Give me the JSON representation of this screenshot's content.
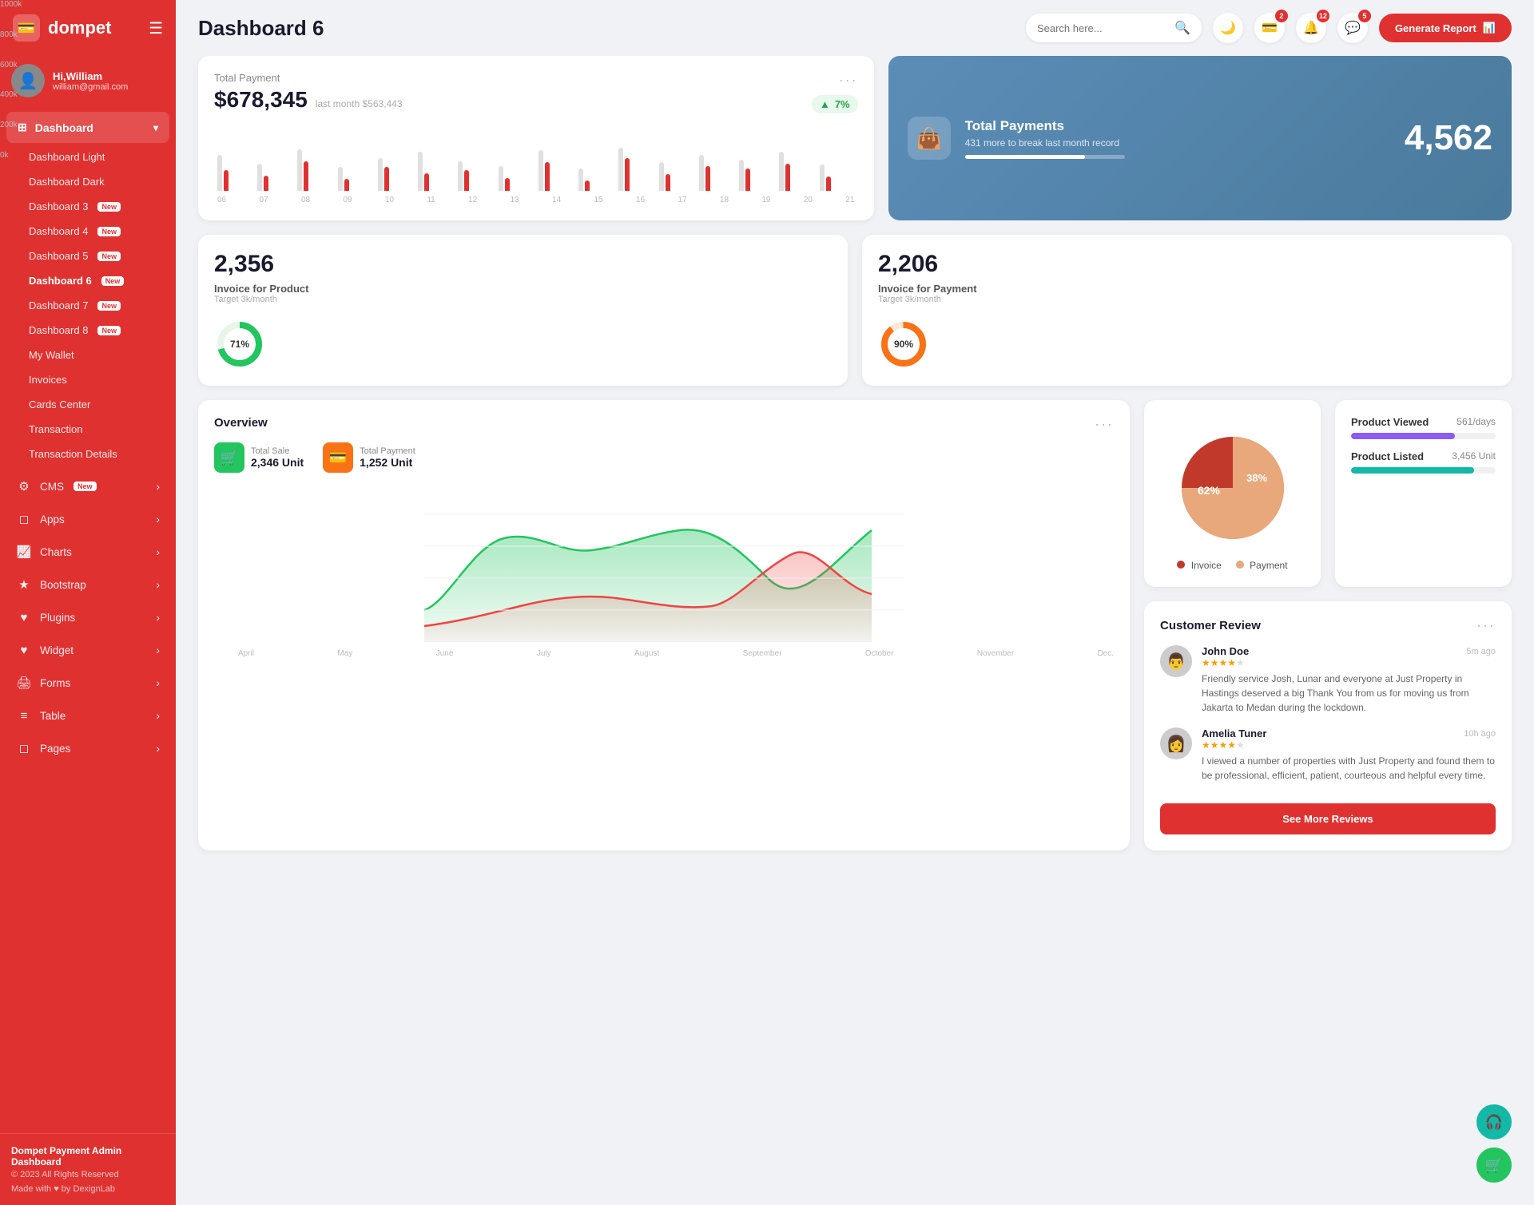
{
  "sidebar": {
    "logo": "dompet",
    "logo_icon": "💳",
    "user": {
      "greeting": "Hi,William",
      "email": "william@gmail.com",
      "avatar": "👤"
    },
    "dashboard_section": {
      "label": "Dashboard",
      "icon": "⊞",
      "items": [
        {
          "label": "Dashboard Light",
          "badge": ""
        },
        {
          "label": "Dashboard Dark",
          "badge": ""
        },
        {
          "label": "Dashboard 3",
          "badge": "New"
        },
        {
          "label": "Dashboard 4",
          "badge": "New"
        },
        {
          "label": "Dashboard 5",
          "badge": "New"
        },
        {
          "label": "Dashboard 6",
          "badge": "New",
          "active": true
        },
        {
          "label": "Dashboard 7",
          "badge": "New"
        },
        {
          "label": "Dashboard 8",
          "badge": "New"
        },
        {
          "label": "My Wallet",
          "badge": ""
        },
        {
          "label": "Invoices",
          "badge": ""
        },
        {
          "label": "Cards Center",
          "badge": ""
        },
        {
          "label": "Transaction",
          "badge": ""
        },
        {
          "label": "Transaction Details",
          "badge": ""
        }
      ]
    },
    "nav_items": [
      {
        "label": "CMS",
        "icon": "⚙",
        "badge": "New",
        "has_arrow": true
      },
      {
        "label": "Apps",
        "icon": "◻",
        "badge": "",
        "has_arrow": true
      },
      {
        "label": "Charts",
        "icon": "📈",
        "badge": "",
        "has_arrow": true
      },
      {
        "label": "Bootstrap",
        "icon": "★",
        "badge": "",
        "has_arrow": true
      },
      {
        "label": "Plugins",
        "icon": "♥",
        "badge": "",
        "has_arrow": true
      },
      {
        "label": "Widget",
        "icon": "♥",
        "badge": "",
        "has_arrow": true
      },
      {
        "label": "Forms",
        "icon": "🖨",
        "badge": "",
        "has_arrow": true
      },
      {
        "label": "Table",
        "icon": "≡",
        "badge": "",
        "has_arrow": true
      },
      {
        "label": "Pages",
        "icon": "◻",
        "badge": "",
        "has_arrow": true
      }
    ],
    "footer": {
      "brand": "Dompet Payment Admin Dashboard",
      "copy": "© 2023 All Rights Reserved",
      "made": "Made with ♥ by DexignLab"
    }
  },
  "topbar": {
    "title": "Dashboard 6",
    "search_placeholder": "Search here...",
    "badges": {
      "wallet": "2",
      "bell": "12",
      "chat": "5"
    },
    "generate_btn": "Generate Report"
  },
  "total_payment": {
    "label": "Total Payment",
    "amount": "$678,345",
    "last_month_label": "last month",
    "last_month_value": "$563,443",
    "trend": "7%",
    "bar_labels": [
      "06",
      "07",
      "08",
      "09",
      "10",
      "11",
      "12",
      "13",
      "14",
      "15",
      "16",
      "17",
      "18",
      "19",
      "20",
      "21"
    ],
    "bars": [
      {
        "gray": 60,
        "red": 35
      },
      {
        "gray": 45,
        "red": 25
      },
      {
        "gray": 70,
        "red": 50
      },
      {
        "gray": 40,
        "red": 20
      },
      {
        "gray": 55,
        "red": 40
      },
      {
        "gray": 65,
        "red": 30
      },
      {
        "gray": 50,
        "red": 35
      },
      {
        "gray": 42,
        "red": 22
      },
      {
        "gray": 68,
        "red": 48
      },
      {
        "gray": 38,
        "red": 18
      },
      {
        "gray": 72,
        "red": 55
      },
      {
        "gray": 48,
        "red": 28
      },
      {
        "gray": 60,
        "red": 42
      },
      {
        "gray": 52,
        "red": 38
      },
      {
        "gray": 65,
        "red": 45
      },
      {
        "gray": 44,
        "red": 24
      }
    ]
  },
  "total_payments_blue": {
    "title": "Total Payments",
    "sub": "431 more to break last month record",
    "value": "4,562",
    "progress": 75,
    "icon": "👜"
  },
  "invoice_product": {
    "value": "2,356",
    "label": "Invoice for Product",
    "target": "Target 3k/month",
    "percent": 71,
    "color": "#22c55e"
  },
  "invoice_payment": {
    "value": "2,206",
    "label": "Invoice for Payment",
    "target": "Target 3k/month",
    "percent": 90,
    "color": "#f97316"
  },
  "overview": {
    "title": "Overview",
    "total_sale_label": "Total Sale",
    "total_sale_value": "2,346 Unit",
    "total_payment_label": "Total Payment",
    "total_payment_value": "1,252 Unit",
    "y_labels": [
      "1000k",
      "800k",
      "600k",
      "400k",
      "200k",
      "0k"
    ],
    "x_labels": [
      "April",
      "May",
      "June",
      "July",
      "August",
      "September",
      "October",
      "November",
      "Dec."
    ]
  },
  "pie_chart": {
    "invoice_pct": 62,
    "payment_pct": 38,
    "invoice_label": "Invoice",
    "payment_label": "Payment",
    "invoice_color": "#c0392b",
    "payment_color": "#e8a87c"
  },
  "product_stats": {
    "viewed_label": "Product Viewed",
    "viewed_value": "561/days",
    "viewed_fill": 72,
    "viewed_color": "#8b5cf6",
    "listed_label": "Product Listed",
    "listed_value": "3,456 Unit",
    "listed_fill": 85,
    "listed_color": "#14b8a6"
  },
  "customer_review": {
    "title": "Customer Review",
    "reviews": [
      {
        "name": "John Doe",
        "time": "5m ago",
        "stars": 4,
        "text": "Friendly service Josh, Lunar and everyone at Just Property in Hastings deserved a big Thank You from us for moving us from Jakarta to Medan during the lockdown.",
        "avatar": "👨"
      },
      {
        "name": "Amelia Tuner",
        "time": "10h ago",
        "stars": 4,
        "text": "I viewed a number of properties with Just Property and found them to be professional, efficient, patient, courteous and helpful every time.",
        "avatar": "👩"
      }
    ],
    "see_more_label": "See More Reviews"
  },
  "floating": {
    "support_icon": "🎧",
    "cart_icon": "🛒"
  }
}
